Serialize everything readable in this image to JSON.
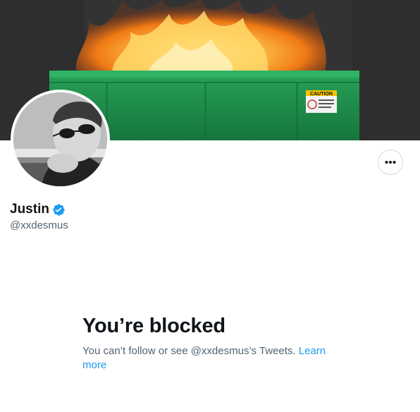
{
  "profile": {
    "display_name": "Justin",
    "handle": "@xxdesmus",
    "verified": true,
    "verified_color": "#1d9bf0"
  },
  "banner": {
    "sign_text": "CAUTION",
    "dumpster_color": "#1f8f4a"
  },
  "actions": {
    "more_icon": "more-horizontal-icon"
  },
  "blocked": {
    "title": "You’re blocked",
    "message": "You can’t follow or see @xxdesmus’s Tweets.",
    "link_label": "Learn more",
    "link_color": "#1d9bf0"
  }
}
